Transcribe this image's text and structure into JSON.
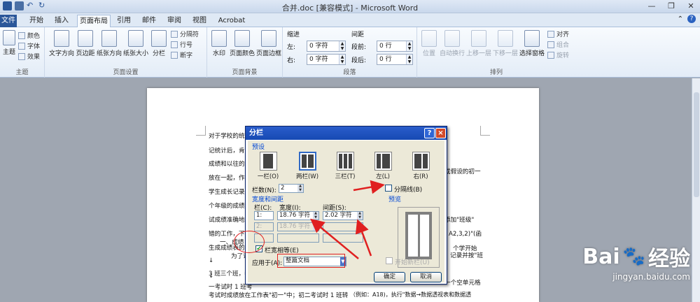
{
  "window": {
    "title": "合并.doc [兼容模式] - Microsoft Word"
  },
  "tabs": [
    "文件",
    "开始",
    "插入",
    "页面布局",
    "引用",
    "邮件",
    "审阅",
    "视图",
    "Acrobat"
  ],
  "ribbon": {
    "theme": {
      "label": "主题",
      "items": [
        "颜色",
        "字体",
        "效果"
      ],
      "big": "主题"
    },
    "page_setup": {
      "label": "页面设置",
      "buttons": [
        "文字方向",
        "页边距",
        "纸张方向",
        "纸张大小",
        "分栏"
      ],
      "small": [
        "分隔符",
        "行号",
        "断字"
      ]
    },
    "page_bg": {
      "label": "页面背景",
      "buttons": [
        "水印",
        "页面颜色",
        "页面边框"
      ]
    },
    "paragraph": {
      "label": "段落",
      "indent_title": "缩进",
      "spacing_title": "间距",
      "left_label": "左:",
      "right_label": "右:",
      "before_label": "段前:",
      "after_label": "段后:",
      "left_val": "0 字符",
      "right_val": "0 字符",
      "before_val": "0 行",
      "after_val": "0 行"
    },
    "arrange": {
      "label": "排列",
      "buttons": [
        "位置",
        "自动换行",
        "上移一层",
        "下移一层",
        "选择窗格"
      ],
      "small": [
        "对齐",
        "组合",
        "旋转"
      ]
    }
  },
  "document": {
    "lines": [
      "对于学校的统计",
      "记统计后，肯令",
      "成绩和以往的统",
      "放在一起，作为",
      "学生成长记录的",
      "个年级的成绩计",
      "试成绩准确地统",
      "错的工作，下面",
      "生成成绩表的方法",
      "↓",
      "一、成绩",
      "↓",
      "为了说明方",
      "3 班三个班，考",
      "一考试时 1 班考",
      "考试时成绩放在工作表\"初一\"中；初二考试时 1 班转"
    ],
    "right_fragments": [
      "或假设的初一",
      "一个空单元格",
      "",
      "添加\"班级\"",
      "A2,3,2)\"(函",
      "个学开始",
      "记录并按\"班",
      "（例如：A18)，执行\"数据→数据透视表和数据透"
    ]
  },
  "dialog": {
    "title": "分栏",
    "help": "?",
    "close": "×",
    "preset_title": "预设",
    "presets": [
      {
        "label": "一栏(O)"
      },
      {
        "label": "两栏(W)"
      },
      {
        "label": "三栏(T)"
      },
      {
        "label": "左(L)"
      },
      {
        "label": "右(R)"
      }
    ],
    "num_cols_label": "栏数(N):",
    "num_cols": "2",
    "separator_label": "分隔线(B)",
    "width_spacing_title": "宽度和间距",
    "preview_title": "预览",
    "col_header": "栏(C):",
    "width_header": "宽度(I):",
    "spacing_header": "间距(S):",
    "row1": {
      "col": "1:",
      "width": "18.76 字符",
      "spacing": "2.02 字符"
    },
    "row2": {
      "col": "2:",
      "width": "18.76 字符",
      "spacing": ""
    },
    "equal_width_label": "栏宽相等(E)",
    "apply_label": "应用于(A):",
    "apply_value": "整篇文档",
    "new_col_label": "开始新栏(U)",
    "ok": "确定",
    "cancel": "取消"
  },
  "watermark": {
    "brand": "Bai",
    "brand2": "经验",
    "url": "jingyan.baidu.com"
  }
}
